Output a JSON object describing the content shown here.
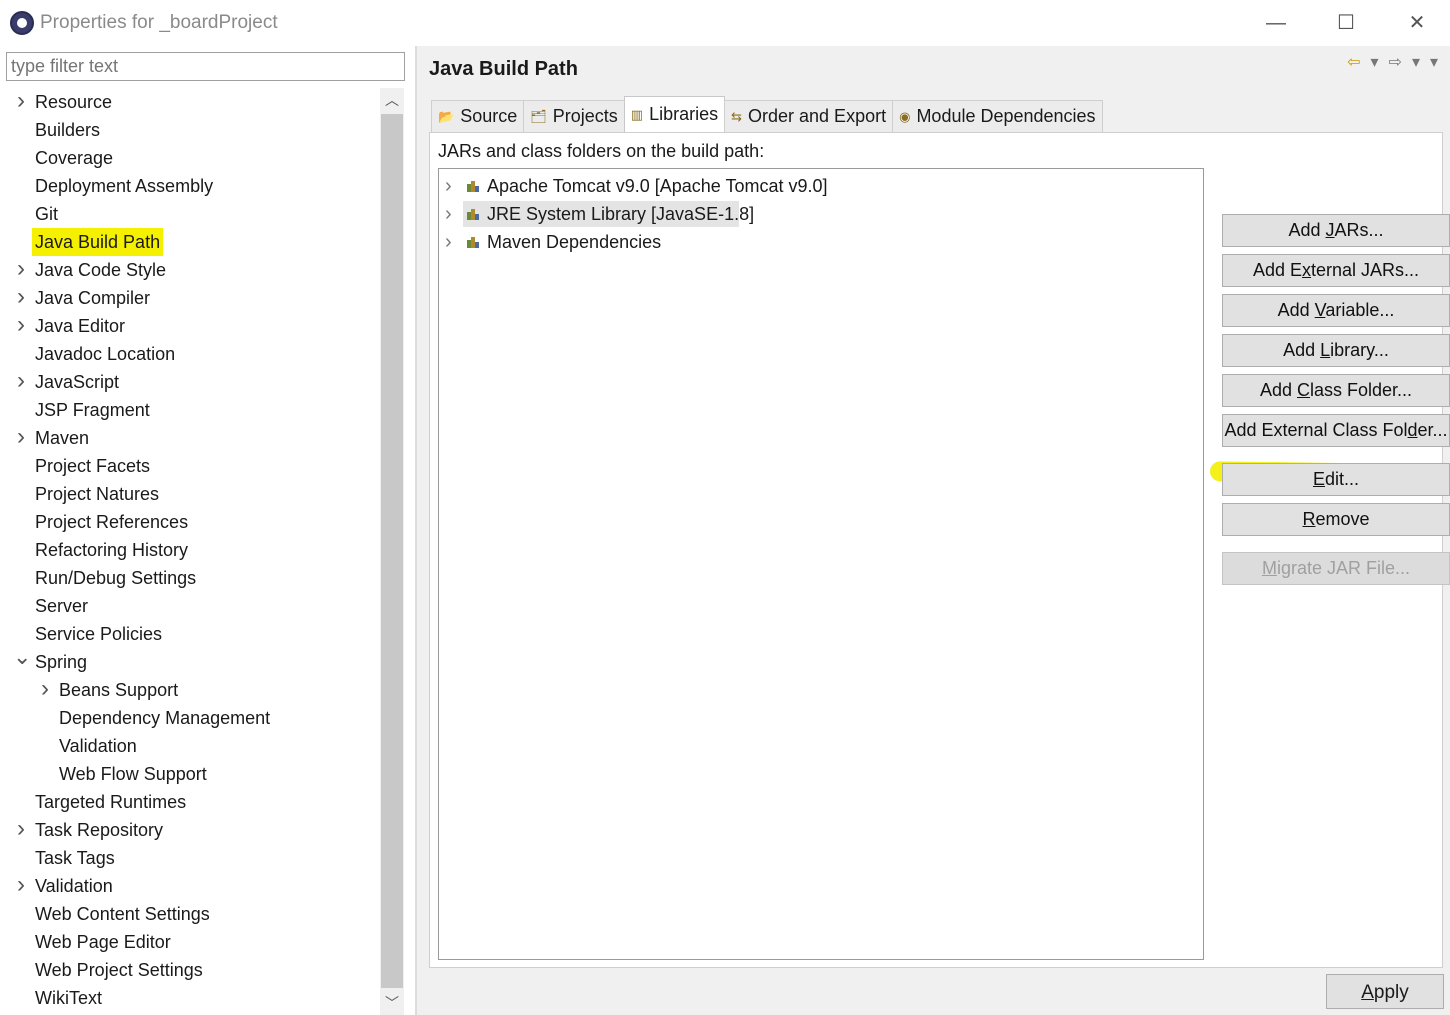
{
  "window": {
    "title": "Properties for _boardProject",
    "minimize_glyph": "—",
    "maximize_glyph": "☐",
    "close_glyph": "✕"
  },
  "filter": {
    "placeholder": "type filter text"
  },
  "tree": [
    {
      "label": "Resource",
      "expandable": true
    },
    {
      "label": "Builders"
    },
    {
      "label": "Coverage"
    },
    {
      "label": "Deployment Assembly"
    },
    {
      "label": "Git"
    },
    {
      "label": "Java Build Path",
      "selected": true
    },
    {
      "label": "Java Code Style",
      "expandable": true
    },
    {
      "label": "Java Compiler",
      "expandable": true
    },
    {
      "label": "Java Editor",
      "expandable": true
    },
    {
      "label": "Javadoc Location"
    },
    {
      "label": "JavaScript",
      "expandable": true
    },
    {
      "label": "JSP Fragment"
    },
    {
      "label": "Maven",
      "expandable": true
    },
    {
      "label": "Project Facets"
    },
    {
      "label": "Project Natures"
    },
    {
      "label": "Project References"
    },
    {
      "label": "Refactoring History"
    },
    {
      "label": "Run/Debug Settings"
    },
    {
      "label": "Server"
    },
    {
      "label": "Service Policies"
    },
    {
      "label": "Spring",
      "expanded": true
    },
    {
      "label": "Beans Support",
      "expandable": true,
      "child": true
    },
    {
      "label": "Dependency Management",
      "child": true
    },
    {
      "label": "Validation",
      "child": true
    },
    {
      "label": "Web Flow Support",
      "child": true
    },
    {
      "label": "Targeted Runtimes"
    },
    {
      "label": "Task Repository",
      "expandable": true
    },
    {
      "label": "Task Tags"
    },
    {
      "label": "Validation",
      "expandable": true
    },
    {
      "label": "Web Content Settings"
    },
    {
      "label": "Web Page Editor"
    },
    {
      "label": "Web Project Settings"
    },
    {
      "label": "WikiText"
    }
  ],
  "page": {
    "title": "Java Build Path",
    "tabs": [
      {
        "label": "Source",
        "icon": "source-folder-icon"
      },
      {
        "label": "Projects",
        "icon": "projects-icon"
      },
      {
        "label": "Libraries",
        "icon": "libraries-icon",
        "active": true
      },
      {
        "label": "Order and Export",
        "icon": "order-export-icon"
      },
      {
        "label": "Module Dependencies",
        "icon": "module-icon"
      }
    ],
    "content_label": "JARs and class folders on the build path:",
    "libraries": [
      {
        "label": "Apache Tomcat v9.0 [Apache Tomcat v9.0]"
      },
      {
        "label": "JRE System Library [JavaSE-1.8]",
        "selected": true
      },
      {
        "label": "Maven Dependencies"
      }
    ],
    "buttons": [
      {
        "pre": "Add ",
        "u": "J",
        "post": "ARs..."
      },
      {
        "pre": "Add E",
        "u": "x",
        "post": "ternal JARs..."
      },
      {
        "pre": "Add ",
        "u": "V",
        "post": "ariable..."
      },
      {
        "pre": "Add ",
        "u": "L",
        "post": "ibrary..."
      },
      {
        "pre": "Add ",
        "u": "C",
        "post": "lass Folder..."
      },
      {
        "pre": "Add External Class Fol",
        "u": "d",
        "post": "er..."
      },
      {
        "pre": "",
        "u": "E",
        "post": "dit..."
      },
      {
        "pre": "",
        "u": "R",
        "post": "emove"
      },
      {
        "pre": "",
        "u": "M",
        "post": "igrate JAR File...",
        "disabled": true
      }
    ],
    "apply": {
      "pre": "",
      "u": "A",
      "post": "pply"
    }
  }
}
